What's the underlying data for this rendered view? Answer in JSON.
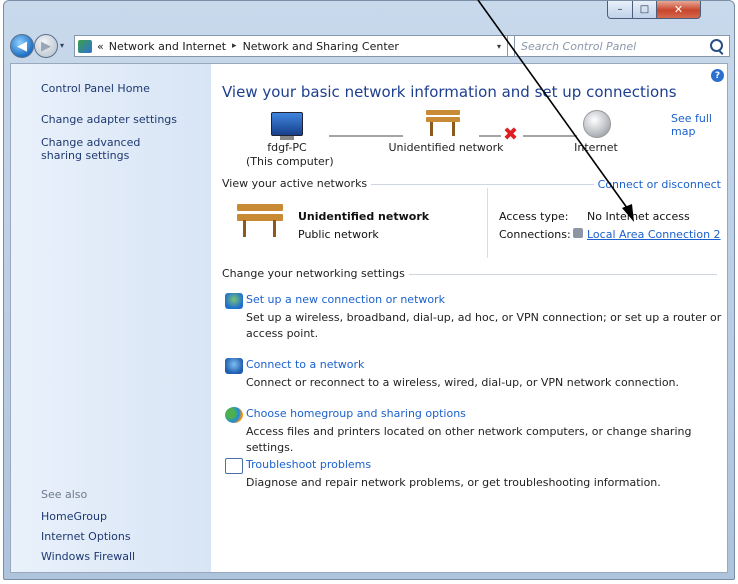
{
  "window": {
    "min_glyph": "–",
    "max_glyph": "□",
    "close_glyph": "✕"
  },
  "nav": {
    "back_glyph": "◀",
    "forward_glyph": "▶",
    "recent_glyph": "▾",
    "address_overflow": "«",
    "breadcrumb": [
      "Network and Internet",
      "Network and Sharing Center"
    ],
    "sep_glyph": "▸",
    "address_dropdown_glyph": "▾",
    "refresh_glyph": "⟳",
    "search_placeholder": "Search Control Panel"
  },
  "sidebar": {
    "home": "Control Panel Home",
    "links": [
      "Change adapter settings",
      "Change advanced sharing settings"
    ],
    "see_also_label": "See also",
    "see_also": [
      "HomeGroup",
      "Internet Options",
      "Windows Firewall"
    ]
  },
  "main": {
    "help_glyph": "?",
    "heading": "View your basic network information and set up connections",
    "see_full_map": "See full map",
    "map": {
      "computer_name": "fdgf-PC",
      "computer_note": "(This computer)",
      "network": "Unidentified network",
      "internet": "Internet",
      "broken_glyph": "✖"
    },
    "active_title": "View your active networks",
    "connect_or_disconnect": "Connect or disconnect",
    "active_network": {
      "name": "Unidentified network",
      "type": "Public network",
      "access_label": "Access type:",
      "access_value": "No Internet access",
      "connections_label": "Connections:",
      "connection_value": "Local Area Connection 2"
    },
    "change_title": "Change your networking settings",
    "tasks": [
      {
        "title": "Set up a new connection or network",
        "desc": "Set up a wireless, broadband, dial-up, ad hoc, or VPN connection; or set up a router or access point."
      },
      {
        "title": "Connect to a network",
        "desc": "Connect or reconnect to a wireless, wired, dial-up, or VPN network connection."
      },
      {
        "title": "Choose homegroup and sharing options",
        "desc": "Access files and printers located on other network computers, or change sharing settings."
      },
      {
        "title": "Troubleshoot problems",
        "desc": "Diagnose and repair network problems, or get troubleshooting information."
      }
    ]
  },
  "colors": {
    "link": "#1b61cc",
    "heading": "#1e3f8f",
    "annotation_arrow": "#000000"
  }
}
